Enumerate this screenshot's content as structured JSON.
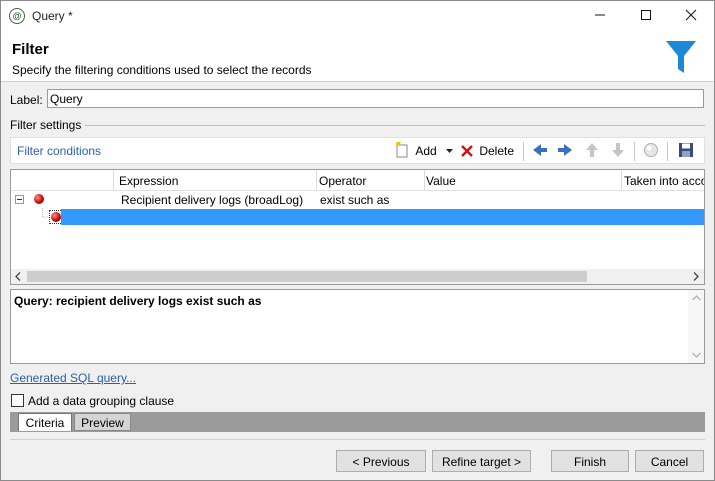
{
  "window": {
    "title": "Query *"
  },
  "header": {
    "title": "Filter",
    "subtitle": "Specify the filtering conditions used to select the records"
  },
  "form": {
    "label_caption": "Label:",
    "label_value": "Query",
    "section_title": "Filter settings"
  },
  "toolbar": {
    "title": "Filter conditions",
    "add_label": "Add",
    "delete_label": "Delete"
  },
  "grid": {
    "columns": [
      "Expression",
      "Operator",
      "Value",
      "Taken into acco"
    ],
    "rows": [
      {
        "expression": "Recipient delivery logs (broadLog)",
        "operator": "exist such as",
        "value": "",
        "taken": ""
      }
    ]
  },
  "description": {
    "text": "Query: recipient delivery logs exist such as"
  },
  "links": {
    "sql": "Generated SQL query..."
  },
  "options": {
    "grouping_label": "Add a data grouping clause",
    "grouping_checked": false
  },
  "tabs": [
    {
      "label": "Criteria",
      "active": true
    },
    {
      "label": "Preview",
      "active": false
    }
  ],
  "buttons": {
    "previous": "< Previous",
    "refine": "Refine target >",
    "finish": "Finish",
    "cancel": "Cancel"
  },
  "colors": {
    "accent": "#3399ff",
    "link": "#2a5fb0",
    "funnel": "#1e88d8"
  }
}
